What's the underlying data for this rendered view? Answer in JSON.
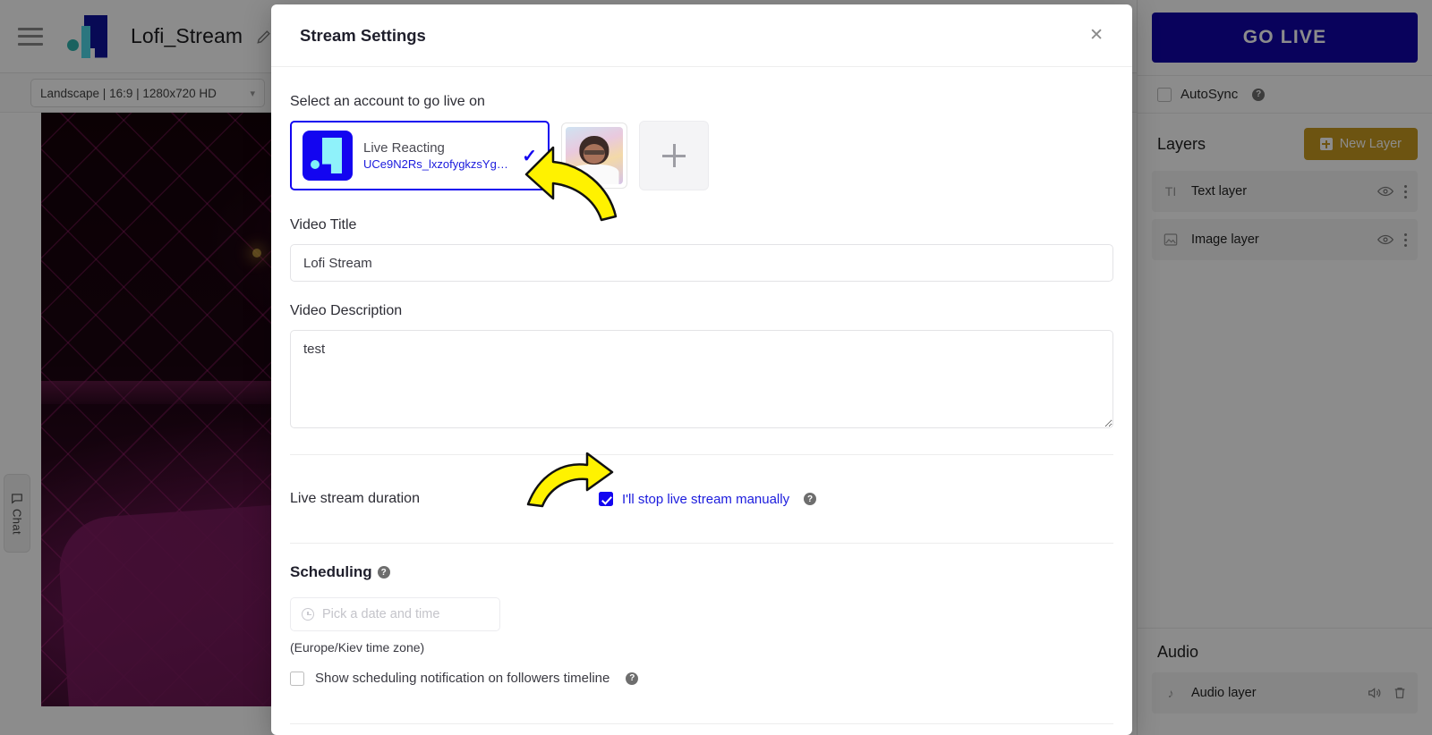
{
  "app": {
    "project_title": "Lofi_Stream",
    "menu_icon": "hamburger-icon",
    "edit_icon": "pencil-icon",
    "ratio_select_value": "Landscape | 16:9 | 1280x720 HD",
    "chat_tab_label": "Chat"
  },
  "sidebar": {
    "go_live_label": "GO LIVE",
    "autosync_label": "AutoSync",
    "autosync_checked": false,
    "help_glyph": "?",
    "layers_title": "Layers",
    "new_layer_label": "New Layer",
    "layers": [
      {
        "name": "Text layer",
        "icon": "text-layer-icon"
      },
      {
        "name": "Image layer",
        "icon": "image-layer-icon"
      }
    ],
    "audio_title": "Audio",
    "audio_layers": [
      {
        "name": "Audio layer",
        "icon": "music-note-icon"
      }
    ]
  },
  "modal": {
    "title": "Stream Settings",
    "close_glyph": "✕",
    "account_section_label": "Select an account to go live on",
    "account": {
      "name": "Live Reacting",
      "channel_id": "UCe9N2Rs_lxzofygkzsYgg…",
      "selected_check": "✓"
    },
    "video_title_label": "Video Title",
    "video_title_value": "Lofi Stream",
    "video_title_placeholder": "Video Title",
    "video_description_label": "Video Description",
    "video_description_value": "test",
    "video_description_placeholder": "Video Description",
    "duration_label": "Live stream duration",
    "duration_checkbox_label": "I'll stop live stream manually",
    "duration_checked": true,
    "scheduling_label": "Scheduling",
    "date_placeholder": "Pick a date and time",
    "timezone_note": "(Europe/Kiev time zone)",
    "notification_label": "Show scheduling notification on followers timeline",
    "notification_checked": false
  },
  "colors": {
    "brand_blue": "#1305f0",
    "go_live": "#1205a8",
    "new_layer": "#c79a20",
    "annotation_arrow": "#FFF200",
    "link_blue": "#1b1bdd"
  }
}
